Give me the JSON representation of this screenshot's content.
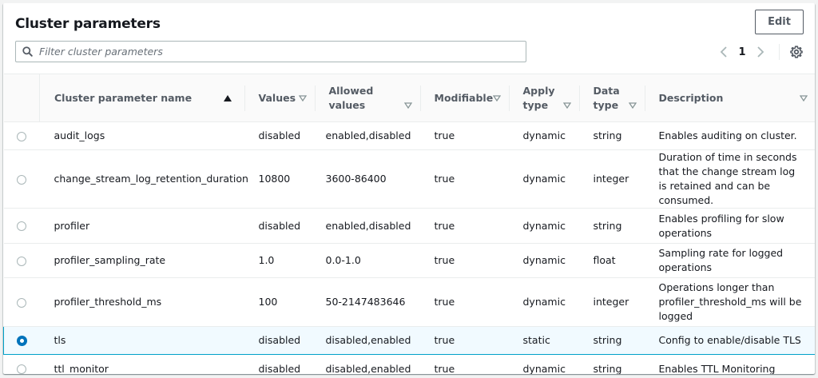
{
  "header": {
    "title": "Cluster parameters",
    "edit_label": "Edit"
  },
  "search": {
    "placeholder": "Filter cluster parameters",
    "value": ""
  },
  "pagination": {
    "current_page": "1"
  },
  "table": {
    "columns": [
      {
        "label": "Cluster parameter name",
        "sort": "ascending"
      },
      {
        "label": "Values"
      },
      {
        "label": "Allowed values"
      },
      {
        "label": "Modifiable"
      },
      {
        "label": "Apply type"
      },
      {
        "label": "Data type"
      },
      {
        "label": "Description"
      }
    ],
    "rows": [
      {
        "name": "audit_logs",
        "value": "disabled",
        "allowed": "enabled,disabled",
        "modifiable": "true",
        "apply": "dynamic",
        "dtype": "string",
        "description": "Enables auditing on cluster.",
        "selected": false
      },
      {
        "name": "change_stream_log_retention_duration",
        "value": "10800",
        "allowed": "3600-86400",
        "modifiable": "true",
        "apply": "dynamic",
        "dtype": "integer",
        "description": "Duration of time in seconds that the change stream log is retained and can be consumed.",
        "selected": false
      },
      {
        "name": "profiler",
        "value": "disabled",
        "allowed": "enabled,disabled",
        "modifiable": "true",
        "apply": "dynamic",
        "dtype": "string",
        "description": "Enables profiling for slow operations",
        "selected": false
      },
      {
        "name": "profiler_sampling_rate",
        "value": "1.0",
        "allowed": "0.0-1.0",
        "modifiable": "true",
        "apply": "dynamic",
        "dtype": "float",
        "description": "Sampling rate for logged operations",
        "selected": false
      },
      {
        "name": "profiler_threshold_ms",
        "value": "100",
        "allowed": "50-2147483646",
        "modifiable": "true",
        "apply": "dynamic",
        "dtype": "integer",
        "description": "Operations longer than profiler_threshold_ms will be logged",
        "selected": false
      },
      {
        "name": "tls",
        "value": "disabled",
        "allowed": "disabled,enabled",
        "modifiable": "true",
        "apply": "static",
        "dtype": "string",
        "description": "Config to enable/disable TLS",
        "selected": true
      },
      {
        "name": "ttl_monitor",
        "value": "disabled",
        "allowed": "disabled,enabled",
        "modifiable": "true",
        "apply": "dynamic",
        "dtype": "string",
        "description": "Enables TTL Monitoring",
        "selected": false
      }
    ]
  },
  "colors": {
    "accent": "#0073bb",
    "selected_border": "#00a1c9",
    "selected_bg": "#f1faff",
    "text": "#16191f",
    "muted": "#545b64"
  },
  "icons": {
    "search": "search-icon",
    "prev": "chevron-left-icon",
    "next": "chevron-right-icon",
    "settings": "gear-icon",
    "sort": "sort-ascending-icon",
    "filter": "caret-down-icon"
  }
}
